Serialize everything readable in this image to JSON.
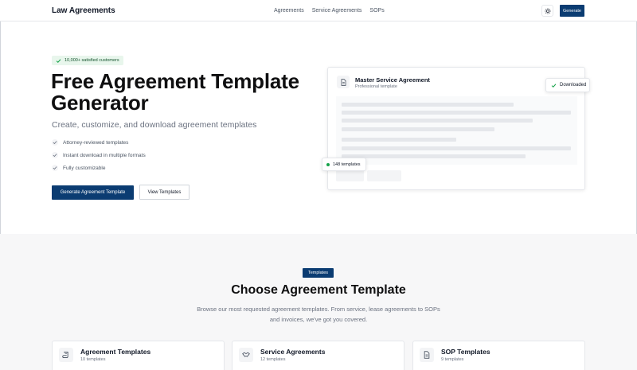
{
  "header": {
    "brand": "Law Agreements",
    "nav": [
      "Agreements",
      "Service Agreements",
      "SOPs"
    ],
    "theme_icon": "sun-icon",
    "generate_label": "Generate"
  },
  "hero": {
    "badge": "10,000+ satisfied customers",
    "title": "Free Agreement Template Generator",
    "subtitle": "Create, customize, and download agreement templates",
    "features": [
      "Attorney-reviewed templates",
      "Instant download in multiple formats",
      "Fully customizable"
    ],
    "primary_cta": "Generate Agreement Template",
    "secondary_cta": "View Templates"
  },
  "preview": {
    "title": "Master Service Agreement",
    "subtitle": "Professional template",
    "downloaded_label": "Downloaded",
    "templates_count_label": "148 templates"
  },
  "templates_section": {
    "badge": "Templates",
    "title": "Choose Agreement Template",
    "description": "Browse our most requested agreement templates. From service, lease agreements to SOPs and invoices, we've got you covered.",
    "cards": [
      {
        "title": "Agreement Templates",
        "count": "10 templates",
        "icon": "scroll-icon"
      },
      {
        "title": "Service Agreements",
        "count": "12 templates",
        "icon": "handshake-icon"
      },
      {
        "title": "SOP Templates",
        "count": "9 templates",
        "icon": "document-icon"
      }
    ]
  },
  "colors": {
    "brand": "#0b3c72",
    "success": "#16a34a",
    "badge_bg": "#e8f6ec"
  }
}
